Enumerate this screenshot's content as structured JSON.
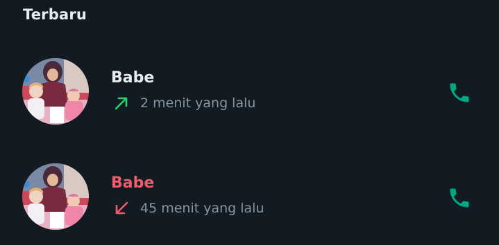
{
  "section": {
    "title": "Terbaru"
  },
  "calls": [
    {
      "name": "Babe",
      "time": "2 menit yang lalu",
      "direction": "outgoing",
      "direction_icon": "arrow-up-right-icon",
      "name_color": "#e9edef",
      "arrow_color": "#25d366"
    },
    {
      "name": "Babe",
      "time": "45 menit yang lalu",
      "direction": "missed",
      "direction_icon": "arrow-down-left-icon",
      "name_color": "#f15c6d",
      "arrow_color": "#f15c6d"
    }
  ],
  "colors": {
    "background": "#121b22",
    "call_icon": "#00a884",
    "secondary_text": "#8696a0"
  },
  "icons": {
    "call": "phone-icon",
    "avatar": "contact-photo"
  }
}
